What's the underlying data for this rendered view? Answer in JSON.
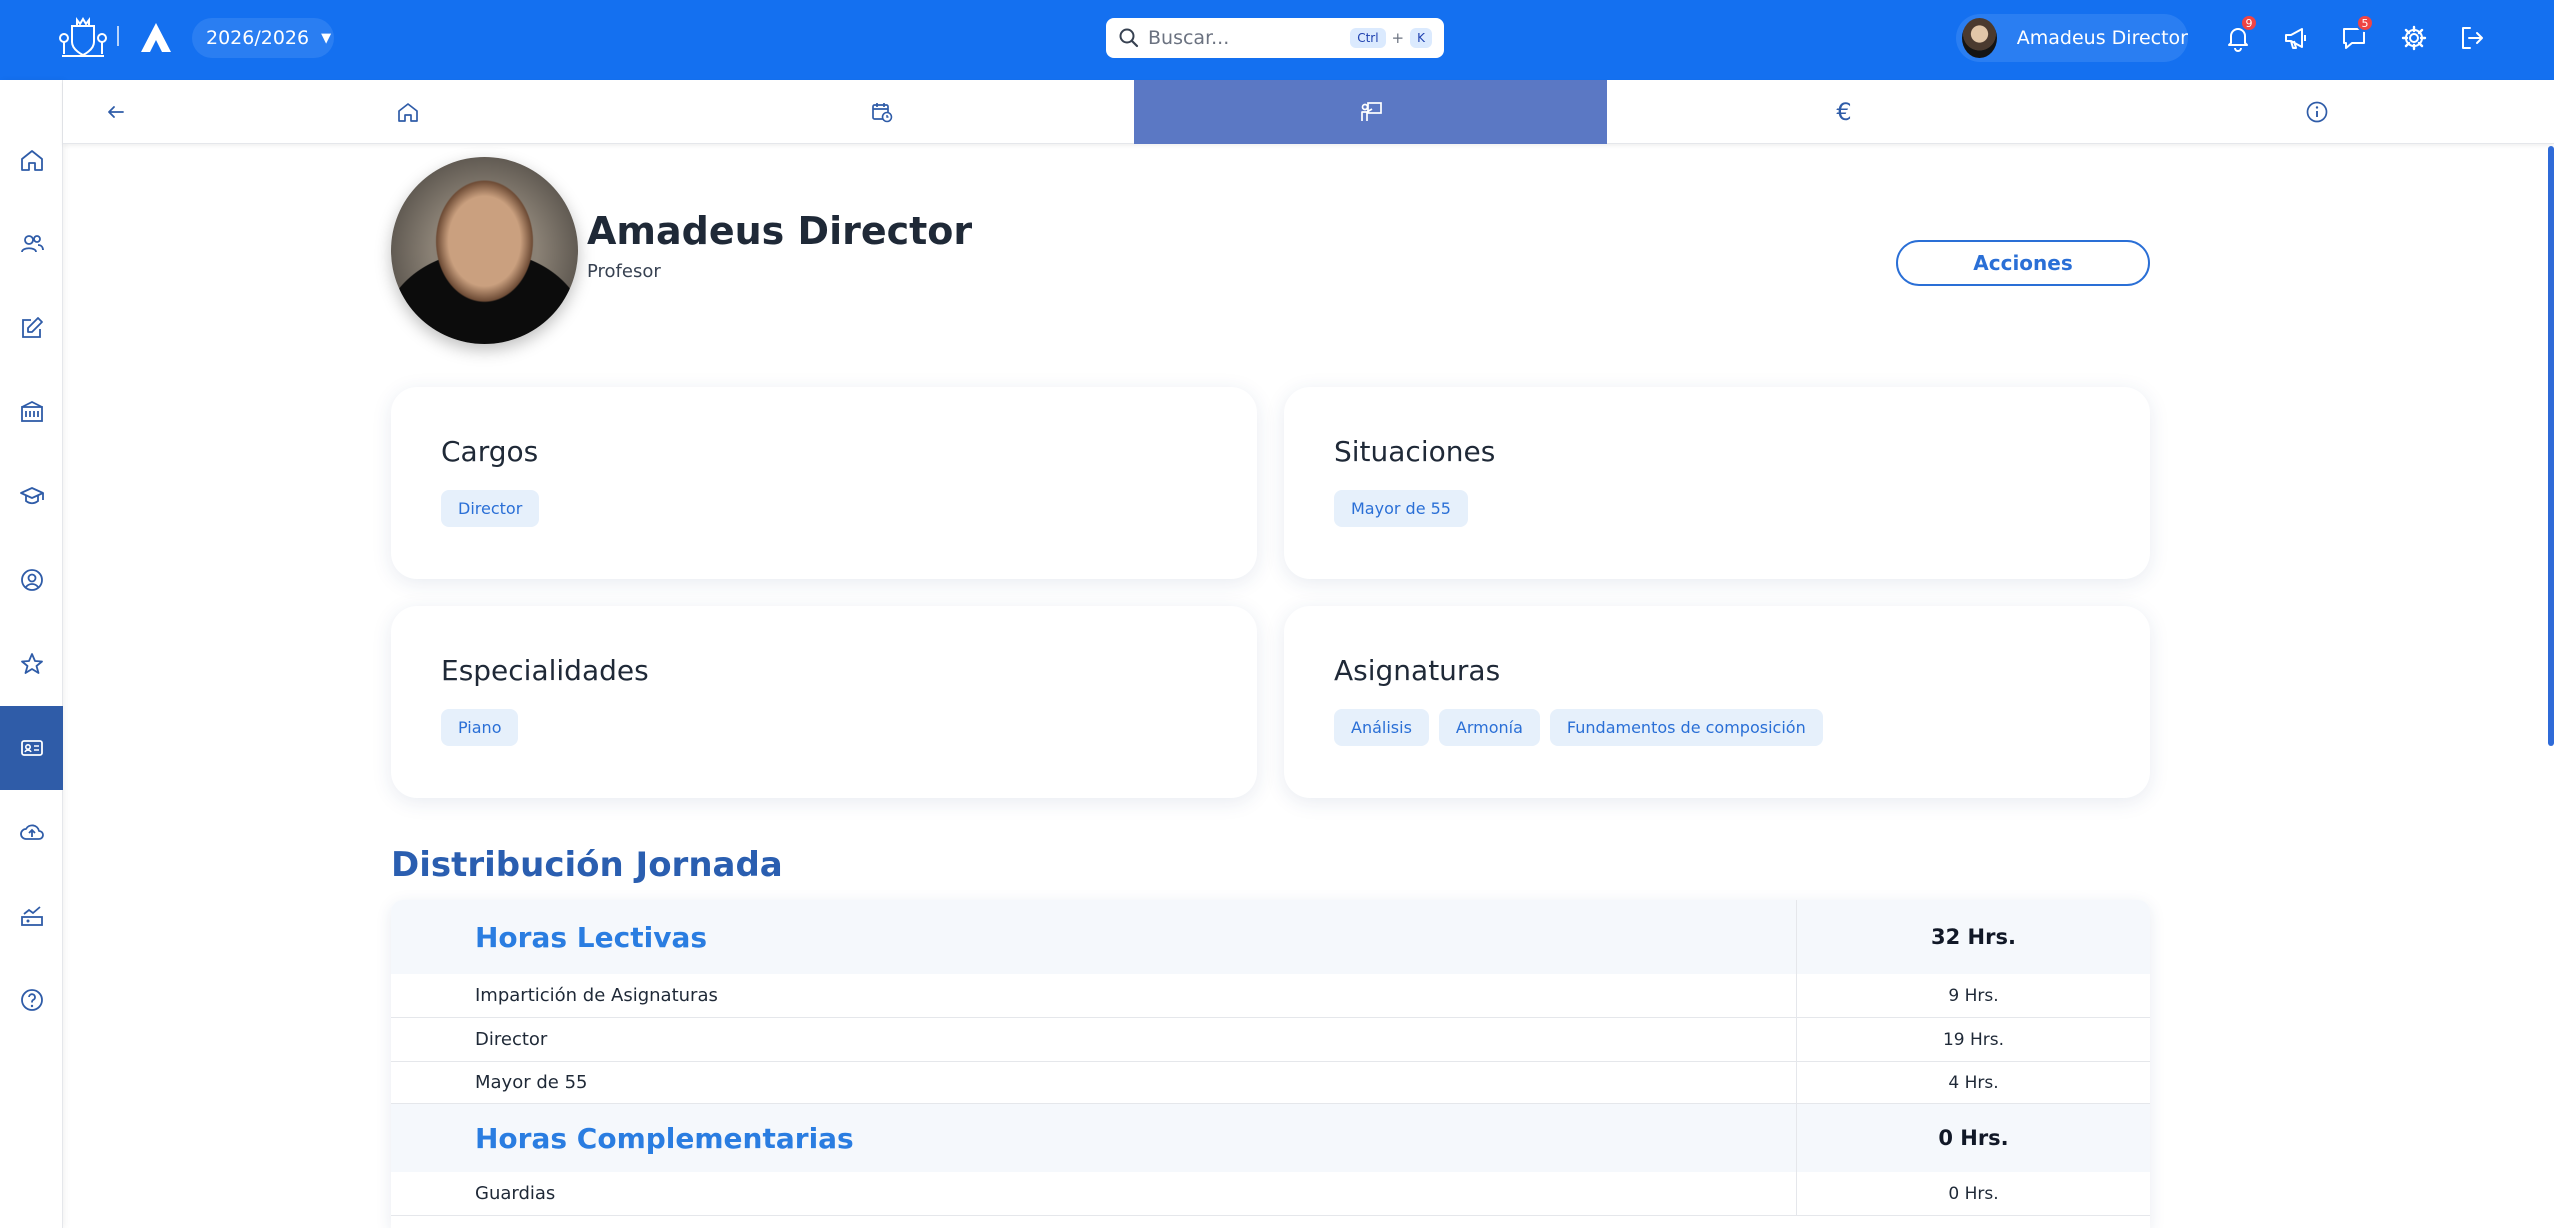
{
  "topbar": {
    "year_selector": "2026/2026",
    "search": {
      "placeholder": "Buscar...",
      "shortcut_key1": "Ctrl",
      "shortcut_plus": "+",
      "shortcut_key2": "K"
    },
    "user_name": "Amadeus Director",
    "notifications_count": "9",
    "messages_count": "5",
    "colors": {
      "bar": "#1470f0",
      "badge": "#ef4444"
    }
  },
  "sidebar": {
    "items": [
      "home-icon",
      "users-icon",
      "edit-icon",
      "school-icon",
      "graduation-cap-icon",
      "user-circle-icon",
      "star-icon",
      "id-card-icon",
      "cloud-upload-icon",
      "chart-icon",
      "help-icon"
    ],
    "active_index": 7,
    "active_color": "#2f5ca8"
  },
  "tabs": {
    "items": [
      "back-arrow-icon",
      "home-icon",
      "calendar-clock-icon",
      "teacher-icon",
      "euro-icon",
      "info-icon"
    ],
    "active_index": 3,
    "active_color": "#5b78c4"
  },
  "profile": {
    "name": "Amadeus Director",
    "role": "Profesor",
    "actions_label": "Acciones"
  },
  "cards": {
    "cargos": {
      "title": "Cargos",
      "chips": [
        "Director"
      ]
    },
    "situaciones": {
      "title": "Situaciones",
      "chips": [
        "Mayor de 55"
      ]
    },
    "especialidades": {
      "title": "Especialidades",
      "chips": [
        "Piano"
      ]
    },
    "asignaturas": {
      "title": "Asignaturas",
      "chips": [
        "Análisis",
        "Armonía",
        "Fundamentos de composición"
      ]
    }
  },
  "distribution": {
    "title": "Distribución Jornada",
    "lectivas": {
      "label": "Horas Lectivas",
      "value": "32 Hrs."
    },
    "rows_lectivas": [
      {
        "label": "Impartición de Asignaturas",
        "value": "9 Hrs."
      },
      {
        "label": "Director",
        "value": "19 Hrs."
      },
      {
        "label": "Mayor de 55",
        "value": "4 Hrs."
      }
    ],
    "complementarias": {
      "label": "Horas Complementarias",
      "value": "0 Hrs."
    },
    "rows_complementarias": [
      {
        "label": "Guardias",
        "value": "0 Hrs."
      }
    ]
  }
}
